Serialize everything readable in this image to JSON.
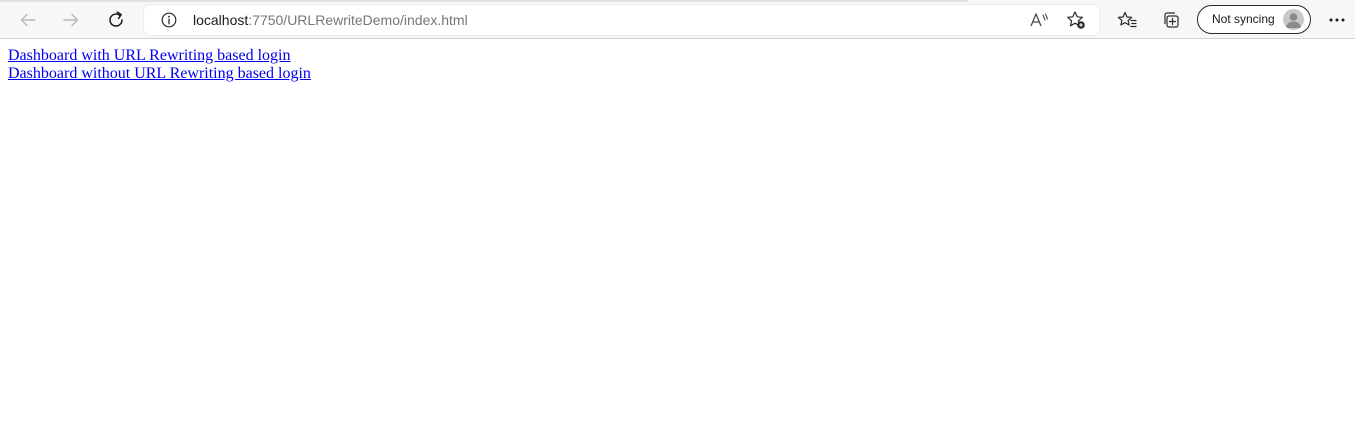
{
  "browser": {
    "address_bar": {
      "host": "localhost",
      "path": ":7750/URLRewriteDemo/index.html"
    },
    "profile": {
      "sync_label": "Not syncing"
    },
    "icons": {
      "back": "back-arrow-icon",
      "forward": "forward-arrow-icon",
      "refresh": "refresh-icon",
      "site_info": "info-icon",
      "read_aloud": "read-aloud-icon",
      "add_favorite": "star-add-icon",
      "favorites": "favorites-icon",
      "collections": "collections-icon",
      "avatar": "avatar-icon",
      "menu": "more-dots-icon"
    }
  },
  "page": {
    "links": [
      {
        "text": "Dashboard with URL Rewriting based login"
      },
      {
        "text": "Dashboard without URL Rewriting based login"
      }
    ],
    "link_color": "#0000ee"
  }
}
